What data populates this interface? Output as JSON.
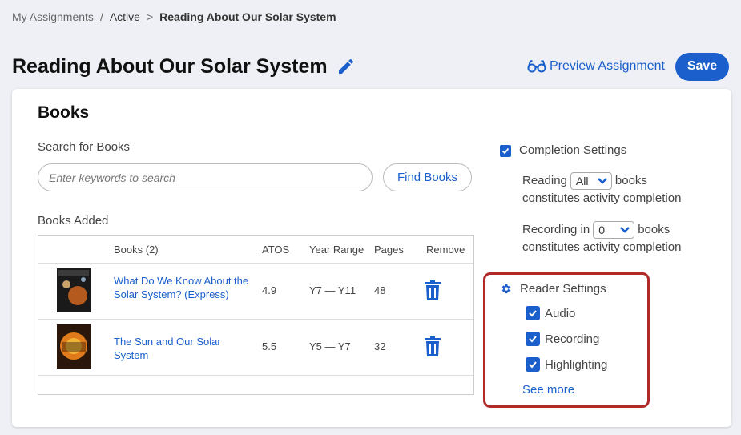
{
  "breadcrumb": {
    "root": "My Assignments",
    "sep1": "/",
    "active": "Active",
    "sep2": ">",
    "current": "Reading About Our Solar System"
  },
  "header": {
    "title": "Reading About Our Solar System",
    "preview_label": "Preview Assignment",
    "save_label": "Save"
  },
  "books_section": {
    "heading": "Books",
    "search_label": "Search for Books",
    "search_placeholder": "Enter keywords to search",
    "find_books_label": "Find Books",
    "books_added_label": "Books Added",
    "columns": [
      "Books (2)",
      "ATOS",
      "Year Range",
      "Pages",
      "Remove"
    ],
    "rows": [
      {
        "title": "What Do We Know About the Solar System? (Express)",
        "atos": "4.9",
        "year_range": "Y7 — Y11",
        "pages": "48"
      },
      {
        "title": "The Sun and Our Solar System",
        "atos": "5.5",
        "year_range": "Y5 — Y7",
        "pages": "32"
      }
    ]
  },
  "completion_settings": {
    "heading": "Completion Settings",
    "reading_prefix": "Reading",
    "reading_value": "All",
    "reading_suffix": "books",
    "reading_line2": "constitutes activity completion",
    "recording_prefix": "Recording in",
    "recording_value": "0",
    "recording_suffix": "books",
    "recording_line2": "constitutes activity completion"
  },
  "reader_settings": {
    "heading": "Reader Settings",
    "options": [
      {
        "label": "Audio",
        "checked": true
      },
      {
        "label": "Recording",
        "checked": true
      },
      {
        "label": "Highlighting",
        "checked": true
      }
    ],
    "see_more": "See more"
  },
  "colors": {
    "accent": "#1a5fcc",
    "highlight_border": "#b02a2a",
    "background": "#eef0f5"
  }
}
